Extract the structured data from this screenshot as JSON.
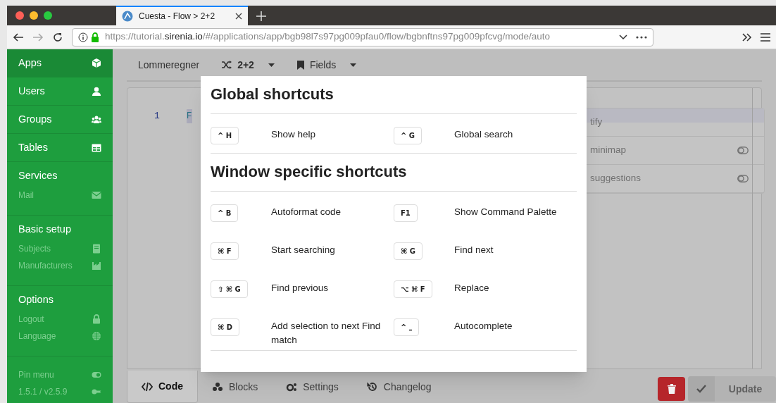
{
  "browser": {
    "tab_title": "Cuesta - Flow > 2+2",
    "url_prefix": "https://tutorial.",
    "url_domain": "sirenia.io",
    "url_rest": "/#/applications/app/bgb98l7s97pg009pfau0/flow/bgbnftns97pg009pfcvg/mode/auto"
  },
  "sidebar": {
    "sections": [
      {
        "label": "Apps",
        "selected": true
      },
      {
        "label": "Users",
        "selected": false
      },
      {
        "label": "Groups",
        "selected": false
      },
      {
        "label": "Tables",
        "selected": false
      },
      {
        "label": "Services",
        "selected": false,
        "children": [
          {
            "label": "Mail"
          }
        ]
      },
      {
        "label": "Basic setup",
        "selected": false,
        "children": [
          {
            "label": "Subjects"
          },
          {
            "label": "Manufacturers"
          }
        ]
      },
      {
        "label": "Options",
        "selected": false,
        "children": [
          {
            "label": "Logout"
          },
          {
            "label": "Language"
          }
        ]
      }
    ],
    "footer": [
      {
        "label": "Pin menu"
      },
      {
        "label": "1.5.1 / v2.5.9"
      }
    ]
  },
  "toolbar": [
    {
      "label": "Lommeregner",
      "kind": "text"
    },
    {
      "label": "2+2",
      "kind": "flow"
    },
    {
      "label": "Fields",
      "kind": "fields"
    }
  ],
  "editor": {
    "line_number": "1",
    "code": "F"
  },
  "settings_panel": [
    {
      "label": "tify",
      "toggle": false
    },
    {
      "label": "minimap",
      "toggle": true
    },
    {
      "label": "suggestions",
      "toggle": true
    }
  ],
  "bottom_tabs": [
    {
      "label": "Code",
      "selected": true
    },
    {
      "label": "Blocks",
      "selected": false
    },
    {
      "label": "Settings",
      "selected": false
    },
    {
      "label": "Changelog",
      "selected": false
    }
  ],
  "update_button": "Update",
  "dialog": {
    "sections": [
      {
        "title": "Global shortcuts",
        "shortcuts": [
          {
            "key": "^ H",
            "label": "Show help"
          },
          {
            "key": "^ G",
            "label": "Global search"
          }
        ]
      },
      {
        "title": "Window specific shortcuts",
        "shortcuts": [
          {
            "key": "^ B",
            "label": "Autoformat code"
          },
          {
            "key": "F1",
            "label": "Show Command Palette"
          },
          {
            "key": "⌘ F",
            "label": "Start searching"
          },
          {
            "key": "⌘ G",
            "label": "Find next"
          },
          {
            "key": "⇧ ⌘ G",
            "label": "Find previous"
          },
          {
            "key": "⌥ ⌘ F",
            "label": "Replace"
          },
          {
            "key": "⌘ D",
            "label": "Add selection to next Find match"
          },
          {
            "key": "^ ⎵",
            "label": "Autocomplete"
          }
        ]
      }
    ]
  }
}
